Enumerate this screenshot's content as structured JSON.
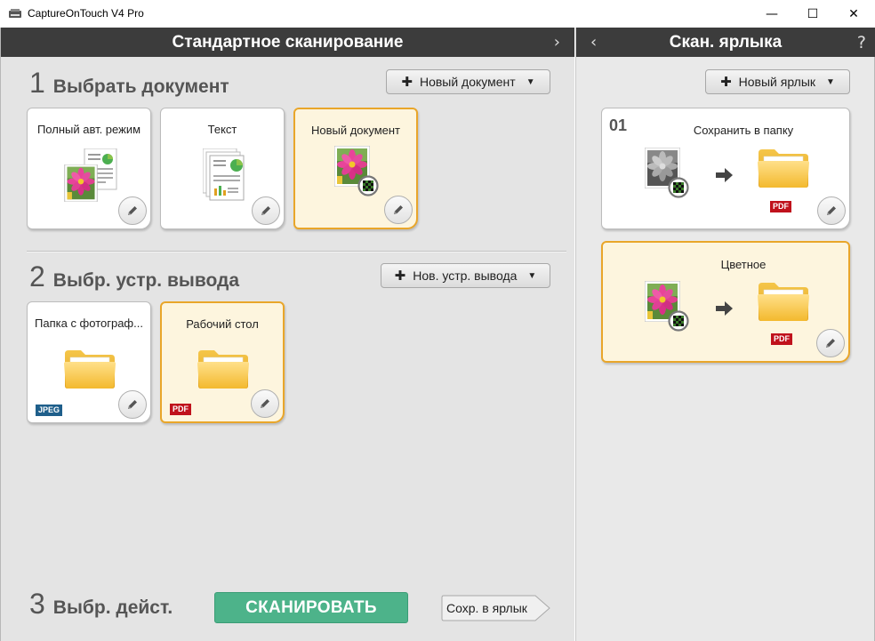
{
  "window": {
    "title": "CaptureOnTouch V4 Pro",
    "controls": {
      "minimize": "—",
      "maximize": "☐",
      "close": "✕"
    }
  },
  "left_pane": {
    "header": "Стандартное сканирование",
    "header_arrow": "›",
    "section1": {
      "number": "1",
      "label": "Выбрать документ",
      "add_button": "Новый документ",
      "cards": [
        {
          "label": "Полный авт. режим",
          "icon": "auto-mode-icon",
          "selected": false
        },
        {
          "label": "Текст",
          "icon": "text-document-icon",
          "selected": false
        },
        {
          "label": "Новый документ",
          "icon": "photo-document-icon",
          "selected": true
        }
      ]
    },
    "section2": {
      "number": "2",
      "label": "Выбр. устр. вывода",
      "add_button": "Нов. устр. вывода",
      "cards": [
        {
          "label": "Папка с фотограф...",
          "icon": "folder-icon",
          "badge": "JPEG",
          "selected": false
        },
        {
          "label": "Рабочий стол",
          "icon": "folder-icon",
          "badge": "PDF",
          "selected": true
        }
      ]
    },
    "section3": {
      "number": "3",
      "label": "Выбр. дейст.",
      "scan_button": "СКАНИРОВАТЬ",
      "save_shortcut_button": "Сохр. в ярлык"
    }
  },
  "right_pane": {
    "header": "Скан. ярлыка",
    "header_arrow": "‹",
    "help": "?",
    "add_button": "Новый ярлык",
    "shortcuts": [
      {
        "number": "01",
        "label": "Сохранить в папку",
        "badge": "PDF",
        "grayscale": true,
        "selected": false
      },
      {
        "number": "",
        "label": "Цветное",
        "badge": "PDF",
        "grayscale": false,
        "selected": true
      }
    ]
  },
  "colors": {
    "header_bg": "#3c3c3c",
    "selected_border": "#e9a62a",
    "selected_bg": "#fdf5de",
    "scan_button": "#4db38a",
    "pdf_badge": "#c0121c",
    "jpeg_badge": "#1f5f8b"
  }
}
